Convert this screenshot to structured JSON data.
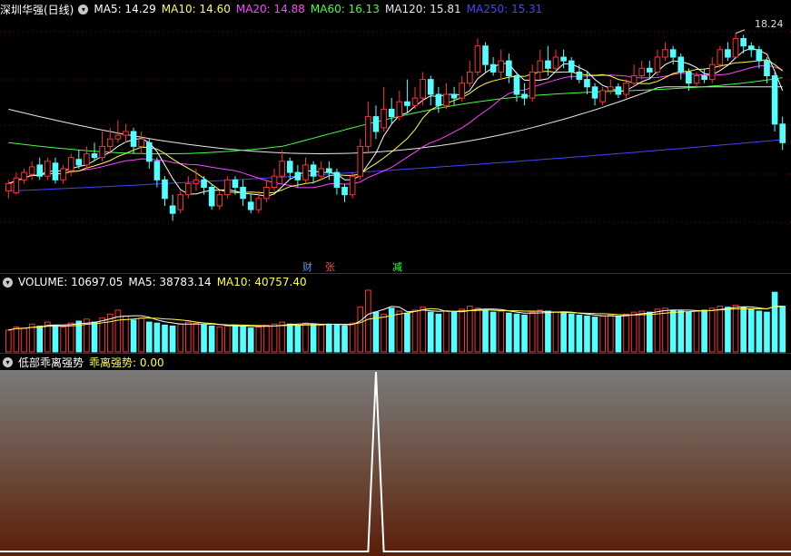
{
  "stock_title": "深圳华强(日线)",
  "ma_labels": [
    {
      "name": "MA5: 14.29",
      "color": "#ffffff"
    },
    {
      "name": "MA10: 14.60",
      "color": "#ffff44"
    },
    {
      "name": "MA20: 14.88",
      "color": "#ff44ff"
    },
    {
      "name": "MA60: 16.13",
      "color": "#44ff44"
    },
    {
      "name": "MA120: 15.81",
      "color": "#e8e8e8"
    },
    {
      "name": "MA250: 15.31",
      "color": "#4444ff"
    }
  ],
  "price_high_label": "18.24",
  "flags": {
    "cai": "财",
    "zhang": "张",
    "jian": "减"
  },
  "volume_header": {
    "title": "VOLUME: 10697.05",
    "ma5": "MA5: 38783.14",
    "ma10": "MA10: 40757.40"
  },
  "indicator_header": {
    "title": "低部乖离强势",
    "value": "乖离强势: 0.00"
  },
  "colors": {
    "up": "#ff3232",
    "down": "#54ffff",
    "ma5": "#ffffff",
    "ma10": "#ffff44",
    "ma20": "#ff44ff",
    "ma60": "#44ff44",
    "ma120": "#e8e8e8",
    "ma250": "#4444ff"
  },
  "chart_data": [
    {
      "type": "candlestick",
      "title": "深圳华强(日线)",
      "ylim": [
        12.6,
        18.6
      ],
      "candles": [
        [
          14.0,
          14.2,
          14.3,
          13.8
        ],
        [
          13.95,
          14.35,
          14.5,
          13.9
        ],
        [
          14.3,
          14.5,
          14.6,
          14.2
        ],
        [
          14.45,
          14.65,
          14.8,
          14.3
        ],
        [
          14.7,
          14.4,
          14.9,
          14.3
        ],
        [
          14.4,
          14.8,
          14.9,
          14.3
        ],
        [
          14.75,
          14.3,
          14.9,
          14.2
        ],
        [
          14.3,
          14.6,
          14.7,
          14.2
        ],
        [
          14.55,
          14.9,
          15.0,
          14.4
        ],
        [
          14.85,
          14.7,
          15.1,
          14.6
        ],
        [
          14.7,
          15.0,
          15.2,
          14.6
        ],
        [
          15.0,
          14.9,
          15.3,
          14.8
        ],
        [
          14.9,
          15.2,
          15.6,
          14.8
        ],
        [
          15.2,
          15.4,
          15.7,
          15.0
        ],
        [
          15.4,
          15.5,
          15.9,
          15.3
        ],
        [
          15.5,
          15.6,
          15.8,
          15.3
        ],
        [
          15.6,
          15.2,
          15.7,
          15.0
        ],
        [
          15.2,
          15.4,
          15.6,
          15.0
        ],
        [
          15.3,
          14.8,
          15.4,
          14.6
        ],
        [
          14.8,
          14.3,
          14.9,
          14.1
        ],
        [
          14.3,
          13.8,
          14.4,
          13.6
        ],
        [
          13.6,
          13.4,
          13.9,
          13.2
        ],
        [
          13.5,
          13.9,
          14.0,
          13.4
        ],
        [
          13.9,
          14.2,
          14.4,
          13.8
        ],
        [
          14.2,
          14.3,
          14.6,
          14.0
        ],
        [
          14.3,
          14.1,
          14.4,
          13.9
        ],
        [
          14.1,
          13.6,
          14.2,
          13.5
        ],
        [
          13.6,
          13.9,
          14.0,
          13.5
        ],
        [
          13.9,
          14.3,
          14.4,
          13.8
        ],
        [
          14.3,
          14.1,
          14.4,
          13.9
        ],
        [
          14.1,
          13.8,
          14.3,
          13.6
        ],
        [
          13.7,
          13.5,
          13.9,
          13.4
        ],
        [
          13.5,
          13.8,
          14.0,
          13.4
        ],
        [
          13.8,
          14.1,
          14.3,
          13.7
        ],
        [
          14.1,
          14.4,
          14.6,
          14.0
        ],
        [
          14.4,
          14.8,
          15.1,
          14.2
        ],
        [
          14.8,
          14.5,
          14.9,
          14.3
        ],
        [
          14.5,
          14.3,
          14.7,
          14.1
        ],
        [
          14.3,
          14.7,
          14.9,
          14.2
        ],
        [
          14.7,
          14.4,
          14.8,
          14.2
        ],
        [
          14.4,
          14.6,
          14.8,
          14.3
        ],
        [
          14.6,
          14.5,
          14.8,
          14.3
        ],
        [
          14.5,
          14.1,
          14.6,
          13.9
        ],
        [
          14.1,
          13.9,
          14.2,
          13.7
        ],
        [
          13.9,
          14.4,
          14.5,
          13.8
        ],
        [
          14.4,
          15.2,
          15.4,
          14.3
        ],
        [
          15.2,
          16.0,
          16.4,
          15.0
        ],
        [
          16.0,
          15.6,
          16.3,
          15.4
        ],
        [
          15.7,
          16.2,
          16.8,
          15.6
        ],
        [
          16.2,
          16.0,
          16.5,
          15.8
        ],
        [
          16.0,
          16.4,
          16.7,
          15.9
        ],
        [
          16.4,
          16.3,
          17.0,
          16.1
        ],
        [
          16.3,
          16.5,
          16.8,
          16.2
        ],
        [
          16.5,
          17.0,
          17.2,
          16.3
        ],
        [
          17.0,
          16.6,
          17.1,
          16.3
        ],
        [
          16.6,
          16.3,
          16.8,
          16.1
        ],
        [
          16.3,
          16.6,
          16.9,
          16.2
        ],
        [
          16.6,
          16.5,
          16.8,
          16.3
        ],
        [
          16.5,
          16.9,
          17.1,
          16.4
        ],
        [
          16.9,
          17.2,
          17.5,
          16.8
        ],
        [
          17.2,
          17.9,
          18.1,
          17.1
        ],
        [
          17.9,
          17.4,
          18.0,
          17.2
        ],
        [
          17.4,
          17.2,
          17.6,
          17.1
        ],
        [
          17.2,
          17.5,
          17.8,
          17.0
        ],
        [
          17.5,
          17.1,
          17.7,
          16.9
        ],
        [
          17.1,
          16.6,
          17.2,
          16.4
        ],
        [
          16.6,
          16.5,
          16.9,
          16.3
        ],
        [
          16.5,
          17.2,
          17.4,
          16.4
        ],
        [
          17.2,
          17.5,
          17.8,
          17.0
        ],
        [
          17.5,
          17.3,
          17.9,
          17.1
        ],
        [
          17.3,
          17.6,
          17.8,
          17.2
        ],
        [
          17.6,
          17.5,
          17.8,
          17.3
        ],
        [
          17.5,
          17.2,
          17.6,
          17.0
        ],
        [
          17.2,
          17.0,
          17.4,
          16.9
        ],
        [
          17.0,
          16.8,
          17.2,
          16.6
        ],
        [
          16.8,
          16.5,
          16.9,
          16.3
        ],
        [
          16.4,
          16.7,
          16.8,
          16.3
        ],
        [
          16.7,
          16.8,
          17.0,
          16.6
        ],
        [
          16.8,
          16.6,
          16.9,
          16.5
        ],
        [
          16.6,
          16.9,
          17.0,
          16.5
        ],
        [
          16.9,
          17.1,
          17.4,
          16.8
        ],
        [
          17.1,
          17.3,
          17.5,
          17.0
        ],
        [
          17.3,
          17.2,
          17.5,
          17.0
        ],
        [
          17.2,
          17.6,
          17.8,
          17.1
        ],
        [
          17.6,
          17.8,
          18.0,
          17.5
        ],
        [
          17.8,
          17.6,
          17.9,
          17.4
        ],
        [
          17.6,
          17.2,
          17.7,
          17.0
        ],
        [
          17.2,
          16.9,
          17.3,
          16.7
        ],
        [
          16.9,
          17.1,
          17.2,
          16.8
        ],
        [
          17.1,
          17.0,
          17.3,
          16.9
        ],
        [
          17.0,
          17.4,
          17.6,
          16.9
        ],
        [
          17.4,
          17.8,
          17.9,
          17.3
        ],
        [
          17.8,
          17.6,
          18.0,
          17.5
        ],
        [
          17.6,
          18.1,
          18.24,
          17.6
        ],
        [
          18.1,
          17.9,
          18.2,
          17.7
        ],
        [
          17.9,
          17.8,
          18.0,
          17.6
        ],
        [
          17.8,
          17.5,
          17.9,
          17.3
        ],
        [
          17.5,
          17.1,
          17.6,
          16.9
        ],
        [
          17.1,
          15.8,
          17.2,
          15.6
        ],
        [
          15.8,
          15.3,
          16.0,
          15.1
        ]
      ]
    },
    {
      "type": "bar",
      "title": "VOLUME",
      "values": [
        22,
        25,
        24,
        28,
        26,
        30,
        27,
        25,
        29,
        31,
        33,
        30,
        34,
        38,
        42,
        36,
        32,
        34,
        30,
        29,
        27,
        26,
        28,
        30,
        29,
        27,
        26,
        25,
        26,
        27,
        26,
        24,
        25,
        27,
        28,
        30,
        28,
        27,
        29,
        28,
        27,
        28,
        27,
        26,
        29,
        45,
        62,
        40,
        38,
        44,
        41,
        39,
        42,
        45,
        40,
        38,
        41,
        40,
        43,
        46,
        44,
        42,
        40,
        41,
        39,
        38,
        37,
        40,
        42,
        41,
        40,
        39,
        38,
        37,
        36,
        35,
        36,
        37,
        36,
        38,
        40,
        41,
        40,
        43,
        44,
        42,
        41,
        40,
        41,
        42,
        44,
        46,
        45,
        47,
        45,
        43,
        41,
        40,
        60,
        46
      ],
      "up": [
        1,
        1,
        1,
        1,
        0,
        1,
        0,
        1,
        1,
        0,
        1,
        0,
        1,
        1,
        1,
        1,
        0,
        1,
        0,
        0,
        0,
        0,
        1,
        1,
        1,
        0,
        0,
        1,
        1,
        0,
        0,
        0,
        1,
        1,
        1,
        1,
        0,
        0,
        1,
        0,
        1,
        0,
        0,
        0,
        1,
        1,
        1,
        0,
        1,
        0,
        1,
        0,
        1,
        1,
        0,
        0,
        1,
        0,
        1,
        1,
        1,
        0,
        0,
        1,
        0,
        0,
        0,
        1,
        1,
        0,
        1,
        0,
        0,
        0,
        0,
        0,
        1,
        1,
        0,
        1,
        1,
        1,
        0,
        1,
        1,
        0,
        0,
        0,
        1,
        0,
        1,
        1,
        0,
        1,
        0,
        0,
        0,
        0,
        0,
        0
      ]
    },
    {
      "type": "line",
      "title": "低部乖离强势",
      "series": [
        {
          "name": "乖离强势",
          "values_sparse": {
            "47": 100
          }
        }
      ],
      "ylim": [
        0,
        100
      ]
    }
  ]
}
